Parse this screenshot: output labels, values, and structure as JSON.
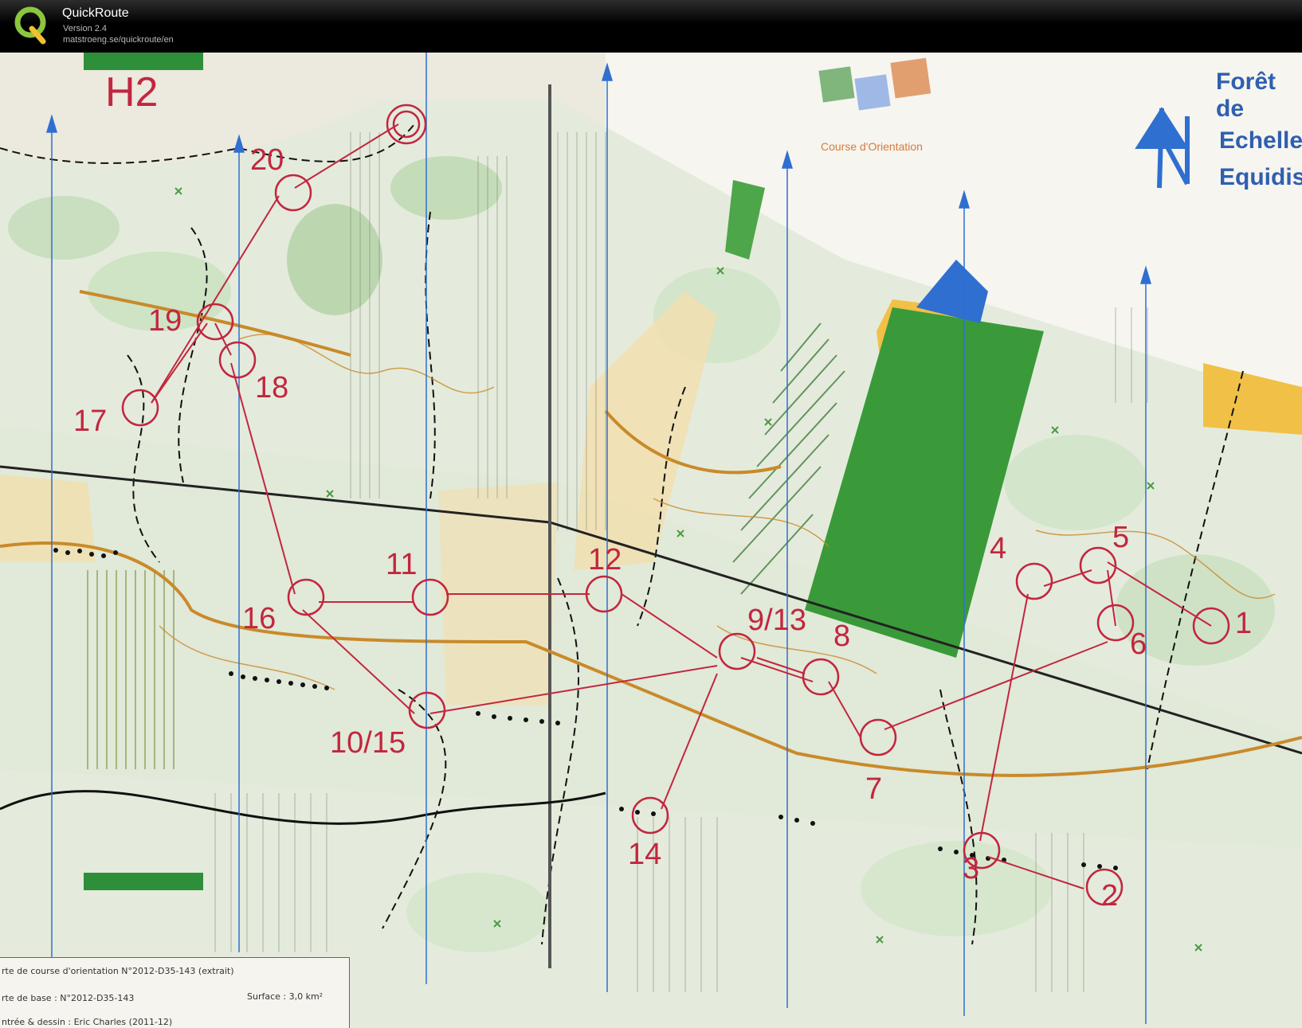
{
  "app": {
    "title": "QuickRoute",
    "version": "Version 2.4",
    "url": "matstroeng.se/quickroute/en"
  },
  "map": {
    "course_name": "H2",
    "controls": [
      "20",
      "19",
      "18",
      "17",
      "16",
      "11",
      "12",
      "10/15",
      "9/13",
      "8",
      "7",
      "14",
      "4",
      "5",
      "6",
      "1",
      "3",
      "2"
    ],
    "header_text": {
      "forest": "Forêt de",
      "scale": "Echelle",
      "contour": "Equidis",
      "ffco_caption": "Course d'Orientation"
    },
    "legend": {
      "line1": "rte de course d'orientation N°2012-D35-143 (extrait)",
      "line2": "rte de base :  N°2012-D35-143",
      "surface": "Surface : 3,0 km²",
      "line3": "ntrée & dessin : Eric Charles (2011-12)"
    },
    "colors": {
      "forest_green": "#3a9a3a",
      "light_green": "#c9dfc0",
      "yellow": "#f1c046",
      "course_magenta": "#c2263f",
      "water_blue": "#2f6fd0",
      "paper": "#f2f0e8"
    }
  }
}
